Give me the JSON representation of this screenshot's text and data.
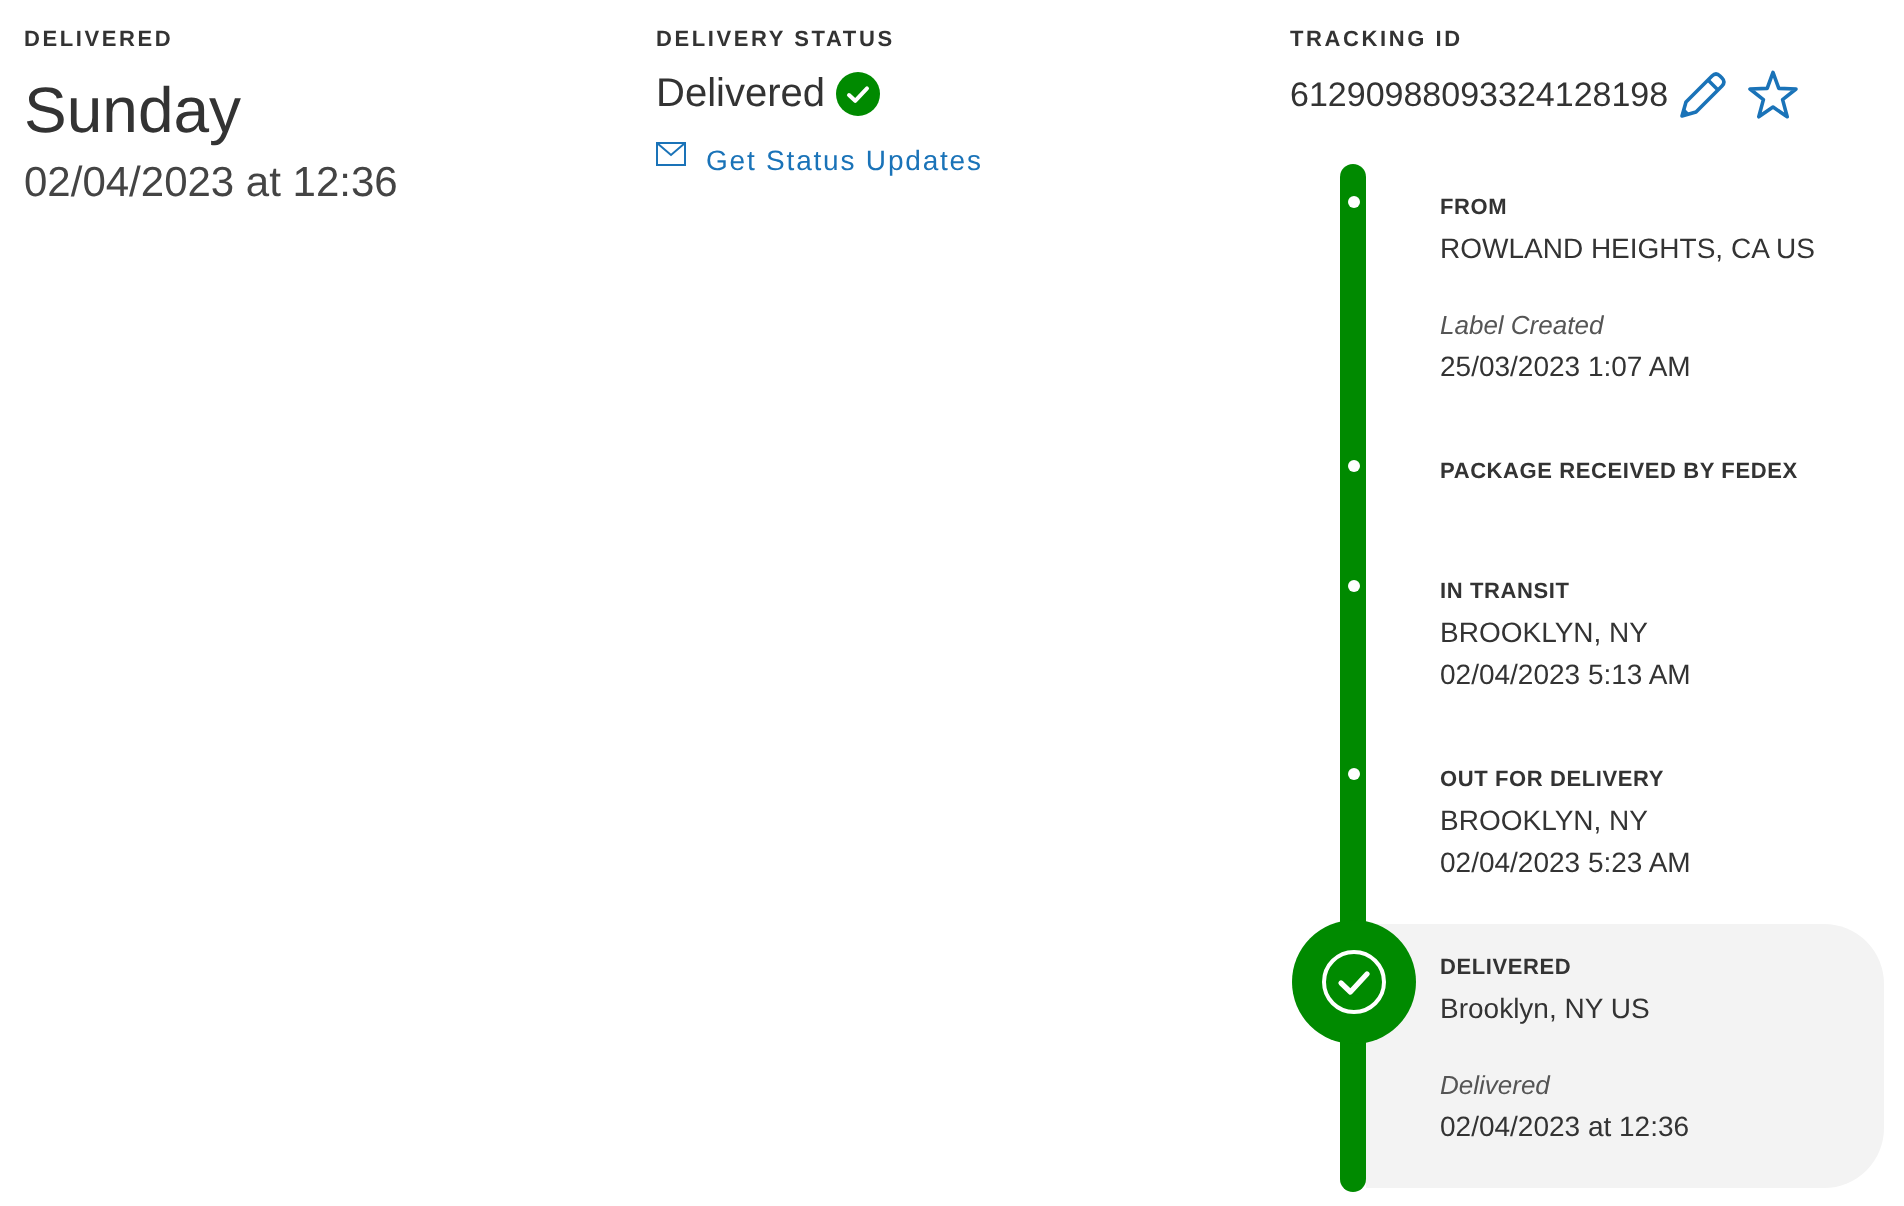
{
  "summary": {
    "label": "DELIVERED",
    "day": "Sunday",
    "date": "02/04/2023 at 12:36"
  },
  "status": {
    "label": "DELIVERY STATUS",
    "value": "Delivered",
    "link": "Get Status Updates"
  },
  "tracking": {
    "label": "TRACKING ID",
    "number": "61290988093324128198",
    "starred": false
  },
  "timeline": [
    {
      "title": "FROM",
      "location": "ROWLAND HEIGHTS, CA US",
      "note": "Label Created",
      "time": "25/03/2023 1:07 AM",
      "current": false
    },
    {
      "title": "PACKAGE RECEIVED BY FEDEX",
      "current": false
    },
    {
      "title": "IN TRANSIT",
      "location": "BROOKLYN, NY",
      "time": "02/04/2023 5:13 AM",
      "current": false
    },
    {
      "title": "OUT FOR DELIVERY",
      "location": "BROOKLYN, NY",
      "time": "02/04/2023 5:23 AM",
      "current": false
    },
    {
      "title": "DELIVERED",
      "location": "Brooklyn, NY US",
      "note": "Delivered",
      "time": "02/04/2023 at 12:36",
      "current": true
    }
  ]
}
